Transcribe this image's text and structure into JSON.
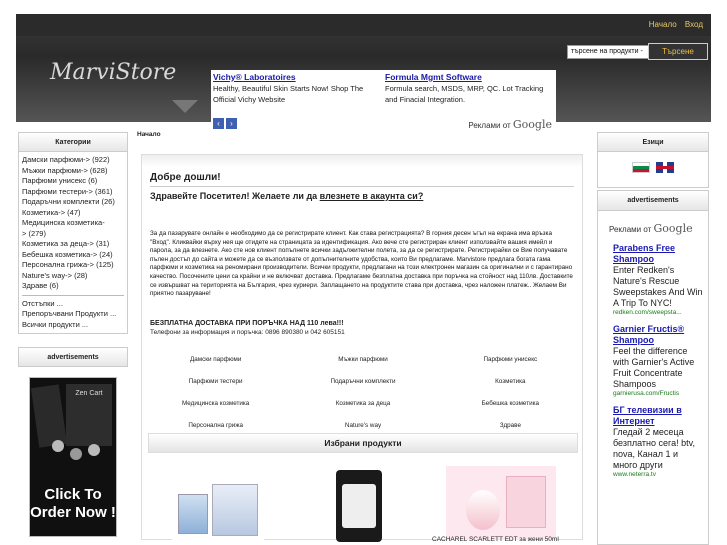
{
  "header": {
    "links": [
      "Начало",
      "Вход"
    ],
    "logo_text": "MarviStore",
    "search_placeholder": "търсене на продукти -",
    "search_button": "Търсене"
  },
  "top_ads": {
    "items": [
      {
        "title": "Vichy® Laboratoires",
        "text": "Healthy, Beautiful Skin Starts Now! Shop The Official Vichy Website"
      },
      {
        "title": "Formula Mgmt Software",
        "text": "Formula search, MSDS, MRP, QC. Lot Tracking and Finacial Integration."
      }
    ],
    "ads_by": "Реклами от",
    "google": "Google",
    "prev": "‹",
    "next": "›"
  },
  "left": {
    "categories_title": "Категории",
    "categories": [
      "Дамски парфюми-> (922)",
      "Мъжки парфюми-> (628)",
      "Парфюми унисекс (6)",
      "Парфюми тестери-> (361)",
      "Подаръчни комплекти (26)",
      "Козметика-> (47)",
      "Медицинска козметика-",
      "> (279)",
      "Козметика за деца-> (31)",
      "Бебешка козметика-> (24)",
      "Персонална грижа-> (125)",
      "Nature's way-> (28)",
      "Здраве (6)"
    ],
    "extra_links": [
      "Отстъпки ...",
      "Препоръчвани Продукти ...",
      "Всички продукти ..."
    ],
    "ads_title": "advertisements",
    "zen_title": "Zen Cart",
    "zen_cta": "Click To Order Now !"
  },
  "main": {
    "breadcrumb": "Начало",
    "welcome_title": "Добре дошли!",
    "greeting_prefix": "Здравейте Посетител! Желаете ли да ",
    "greeting_link": "влезнете в акаунта си?",
    "intro": "За да пазарувате онлайн е необходимо да се регистрирате клиент. Как става регистрацията? В горния десен ъгъл на екрана има връзка \"Вход\". Кликвайки върху нея ще отидете на страницата за идентификация. Ако вече сте регистриран клиент използвайте вашия имейл и парола, за да влезнете. Ако сте нов клиент попълнете всички задължителни полета, за да се регистрирате. Регистрирайки се Вие получавате пълен достъп до сайта и можете да се възползвате от допълнителните удобства, които Ви предлагаме. Marvistore предлага богата гама парфюми и козметика на реномирани производители. Всички продукти, предлагани на този електронен магазин са оригинални и с гарантирано качество. Посочените цени са крайни и не включват доставка. Предлагаме безплатна доставка при поръчка на стойност над 110лв. Доставките се извършват на територията на България, чрез куриери. Заплащането на продуктите става при доставка, чрез наложен платеж.. Желаем Ви приятно пазаруване!",
    "free_delivery": "БЕЗПЛАТНА ДОСТАВКА ПРИ ПОРЪЧКА НАД 110 лева!!!",
    "phones": "Телефони за информация и поръчка: 0896 890380 и 042 605151",
    "category_links": [
      [
        "Дамски парфюми",
        "Мъжки парфюми",
        "Парфюми унисекс"
      ],
      [
        "Парфюми тестери",
        "Подаръчни комплекти",
        "Козметика"
      ],
      [
        "Медицинска козметика",
        "Козметика за деца",
        "Бебешка козметика"
      ],
      [
        "Персонална грижа",
        "Nature's way",
        "Здраве"
      ]
    ],
    "featured_title": "Избрани продукти",
    "product_caption": "CACHAREL SCARLETT EDT за жени 50ml"
  },
  "right": {
    "languages_title": "Езици",
    "ads_title": "advertisements",
    "ads_by": "Реклами от",
    "google": "Google",
    "ads": [
      {
        "title": "Parabens Free Shampoo",
        "text": "Enter Redken's Nature's Rescue Sweepstakes And Win A Trip To NYC!",
        "url": "redken.com/sweepsta..."
      },
      {
        "title": "Garnier Fructis® Shampoo",
        "text": "Feel the difference with Garnier's Active Fruit Concentrate Shampoos",
        "url": "garnierusa.com/Fructis"
      },
      {
        "title": "БГ телевизии в Интернет",
        "text": "Гледай 2 месеца безплатно сега! btv, nova, Канал 1 и много други",
        "url": "www.neterra.tv"
      }
    ]
  }
}
